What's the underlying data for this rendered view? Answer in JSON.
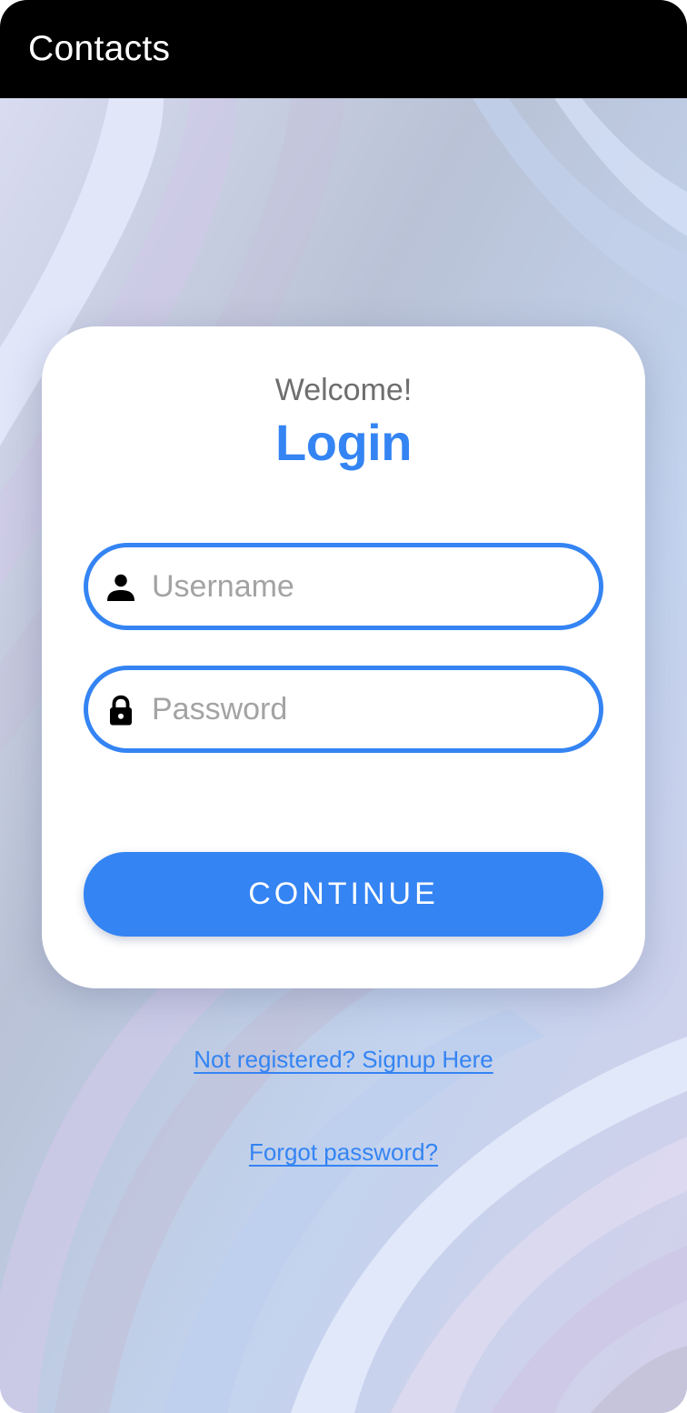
{
  "header": {
    "title": "Contacts",
    "background": "#000000"
  },
  "login_card": {
    "greeting": "Welcome!",
    "title": "Login",
    "username_field": {
      "placeholder": "Username",
      "value": "",
      "icon": "person-icon"
    },
    "password_field": {
      "placeholder": "Password",
      "value": "",
      "icon": "lock-icon"
    },
    "continue_label": "CONTINUE"
  },
  "links": {
    "signup": "Not registered? Signup Here",
    "forgot_password": "Forgot password?"
  },
  "colors": {
    "accent": "#3484f3",
    "greeting_text": "#6e6e6e",
    "placeholder_text": "#a3a3a3"
  }
}
